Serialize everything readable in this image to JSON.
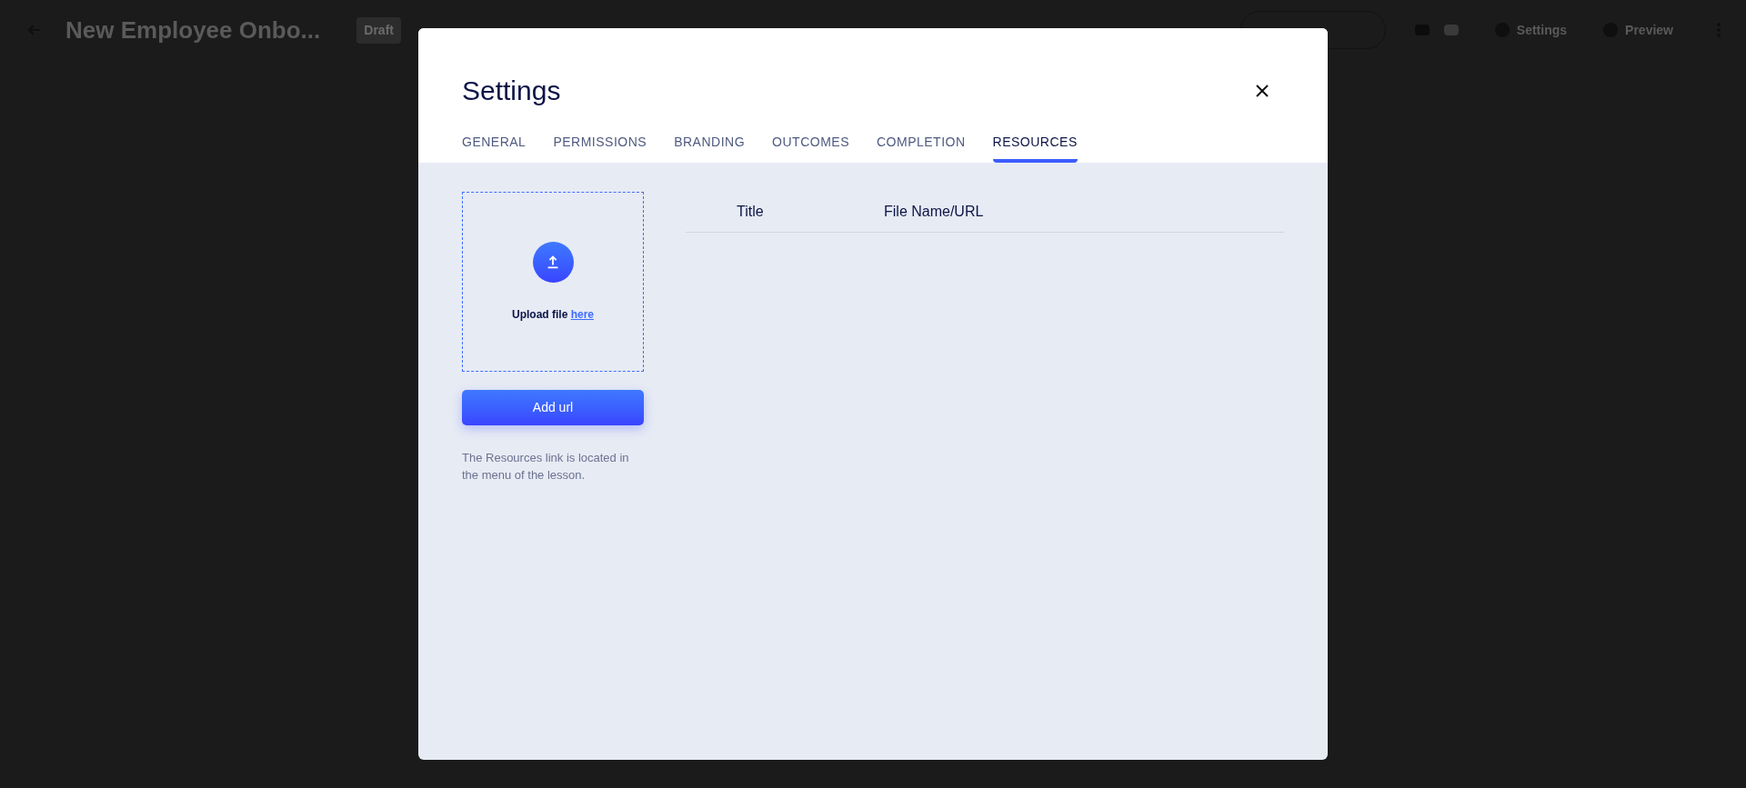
{
  "app_header": {
    "title": "New Employee Onbo...",
    "status_badge": "Draft",
    "actions": [
      {
        "label": "Settings"
      },
      {
        "label": "Preview"
      }
    ]
  },
  "dialog": {
    "title": "Settings",
    "tabs": [
      {
        "label": "GENERAL",
        "selected": false
      },
      {
        "label": "PERMISSIONS",
        "selected": false
      },
      {
        "label": "BRANDING",
        "selected": false
      },
      {
        "label": "OUTCOMES",
        "selected": false
      },
      {
        "label": "COMPLETION",
        "selected": false
      },
      {
        "label": "RESOURCES",
        "selected": true
      }
    ],
    "upload": {
      "text": "Upload file",
      "link": "here"
    },
    "add_url_button": "Add url",
    "hint": "The Resources link is located in the menu of the lesson.",
    "table": {
      "columns": [
        "Title",
        "File Name/URL"
      ]
    }
  }
}
